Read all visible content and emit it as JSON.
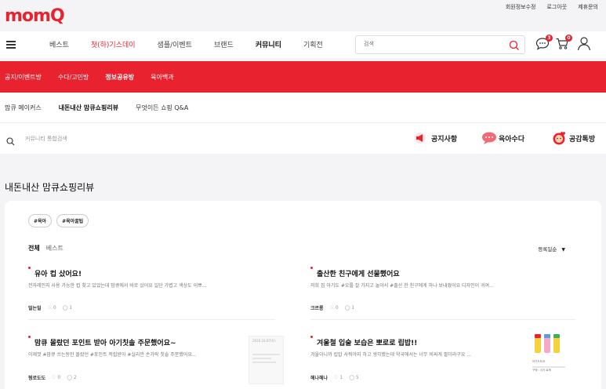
{
  "util": {
    "links": [
      "회원정보수정",
      "로그아웃",
      "제휴문의"
    ]
  },
  "logo": {
    "text": "momQ",
    "color": "#e8222e"
  },
  "nav": {
    "items": [
      "베스트",
      "첫(하)기스데이",
      "샘플/이벤트",
      "브랜드",
      "커뮤니티",
      "기획전"
    ]
  },
  "search": {
    "placeholder": "검색"
  },
  "icons": {
    "chat_badge": "3",
    "cart_badge": "0"
  },
  "red_bar": {
    "items": [
      "공지/이벤트방",
      "수다/고민방",
      "정보공유방",
      "육아백과"
    ],
    "active": "정보공유방"
  },
  "sub_bar": {
    "items": [
      "맘큐 메이커스",
      "내돈내산 맘큐쇼핑리뷰",
      "무엇이든 쇼핑 Q&A"
    ],
    "active": "내돈내산 맘큐쇼핑리뷰"
  },
  "community_search": {
    "placeholder": "커뮤니티 통합검색"
  },
  "quick_links": [
    "공지사항",
    "육아수다",
    "공감톡방"
  ],
  "page": {
    "title": "내돈내산 맘큐쇼핑리뷰"
  },
  "tags": [
    "#육아",
    "#육아꿀팁"
  ],
  "tabs": {
    "all": "전체",
    "best": "베스트"
  },
  "sort": {
    "label": "등록일순"
  },
  "posts": [
    {
      "title": "유아 컵 샀어요!",
      "excerpt": "전자레인지 사용 가능한 컵 찾고 있었는데 맘큐에서 바로 샀어요 일단 가볍고 색상도 이쁘...",
      "author": "밀논밀",
      "likes": "0",
      "comments": "1"
    },
    {
      "title": "출산한 친구에게 선물했어요",
      "excerpt": "저희 집 아기도 #오를 잘 가지고 놀아서 #출산 한 친구에게 하나 보내줬어요 디자인이 귀여...",
      "author": "크르롱",
      "likes": "0",
      "comments": "1"
    },
    {
      "title": "맘큐 몰랐던 포인트 받아 아기칫솔 주문했어요~",
      "excerpt": "이제껏 #맘큐 쓰는동안 몰랐던 #포인트 적립받아 #실리만 손가락 칫솔 주문했어요...",
      "author": "형로도도",
      "likes": "0",
      "comments": "2"
    },
    {
      "title": "겨울철 입술 보습은 뽀로로 립밥!!",
      "excerpt": "겨울이니까 립밥 사줘야지 하고 생각했는데 약국에서는 너무 비싸게 팔더라구요 ...",
      "author": "헤나헤나",
      "likes": "1",
      "comments": "5"
    }
  ],
  "thumb_texts": {
    "t3": "2020.10.07(토)",
    "t4_top": "어기드도라",
    "t4_bottom": "구매 : 사가 로케"
  }
}
